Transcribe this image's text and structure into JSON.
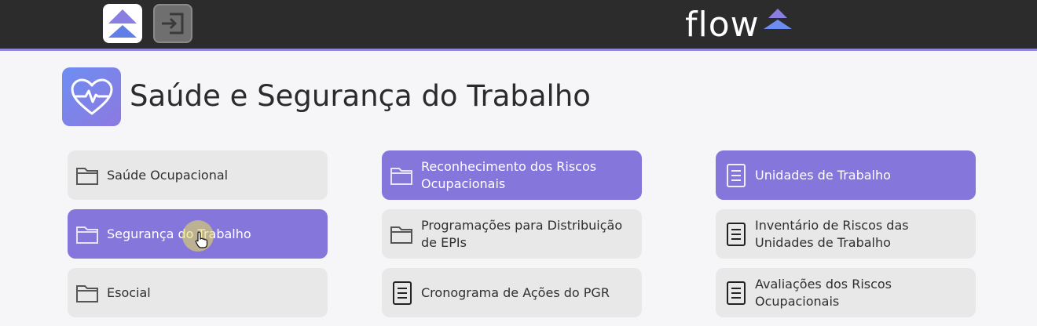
{
  "topbar": {
    "brand": "flow",
    "home_icon": "home-logo-icon",
    "logout_icon": "logout-icon"
  },
  "page": {
    "title": "Saúde e Segurança do Trabalho",
    "icon": "heart-pulse-icon"
  },
  "menu": {
    "col1": [
      {
        "label": "Saúde Ocupacional",
        "icon": "folder-icon",
        "active": false
      },
      {
        "label": "Segurança do Trabalho",
        "icon": "folder-icon",
        "active": true
      },
      {
        "label": "Esocial",
        "icon": "folder-icon",
        "active": false
      }
    ],
    "col2": [
      {
        "label": "Reconhecimento dos Riscos Ocupacionais",
        "icon": "folder-icon",
        "active": true
      },
      {
        "label": "Programações para Distribuição de EPIs",
        "icon": "folder-icon",
        "active": false
      },
      {
        "label": "Cronograma de Ações do PGR",
        "icon": "document-icon",
        "active": false
      }
    ],
    "col3": [
      {
        "label": "Unidades de Trabalho",
        "icon": "document-icon",
        "active": true
      },
      {
        "label": "Inventário de Riscos das Unidades de Trabalho",
        "icon": "document-icon",
        "active": false
      },
      {
        "label": "Avaliações dos Riscos Ocupacionais",
        "icon": "document-icon",
        "active": false
      }
    ]
  },
  "colors": {
    "accent": "#8576dc",
    "topbar": "#2c2c2c",
    "card": "#e8e8e8"
  }
}
